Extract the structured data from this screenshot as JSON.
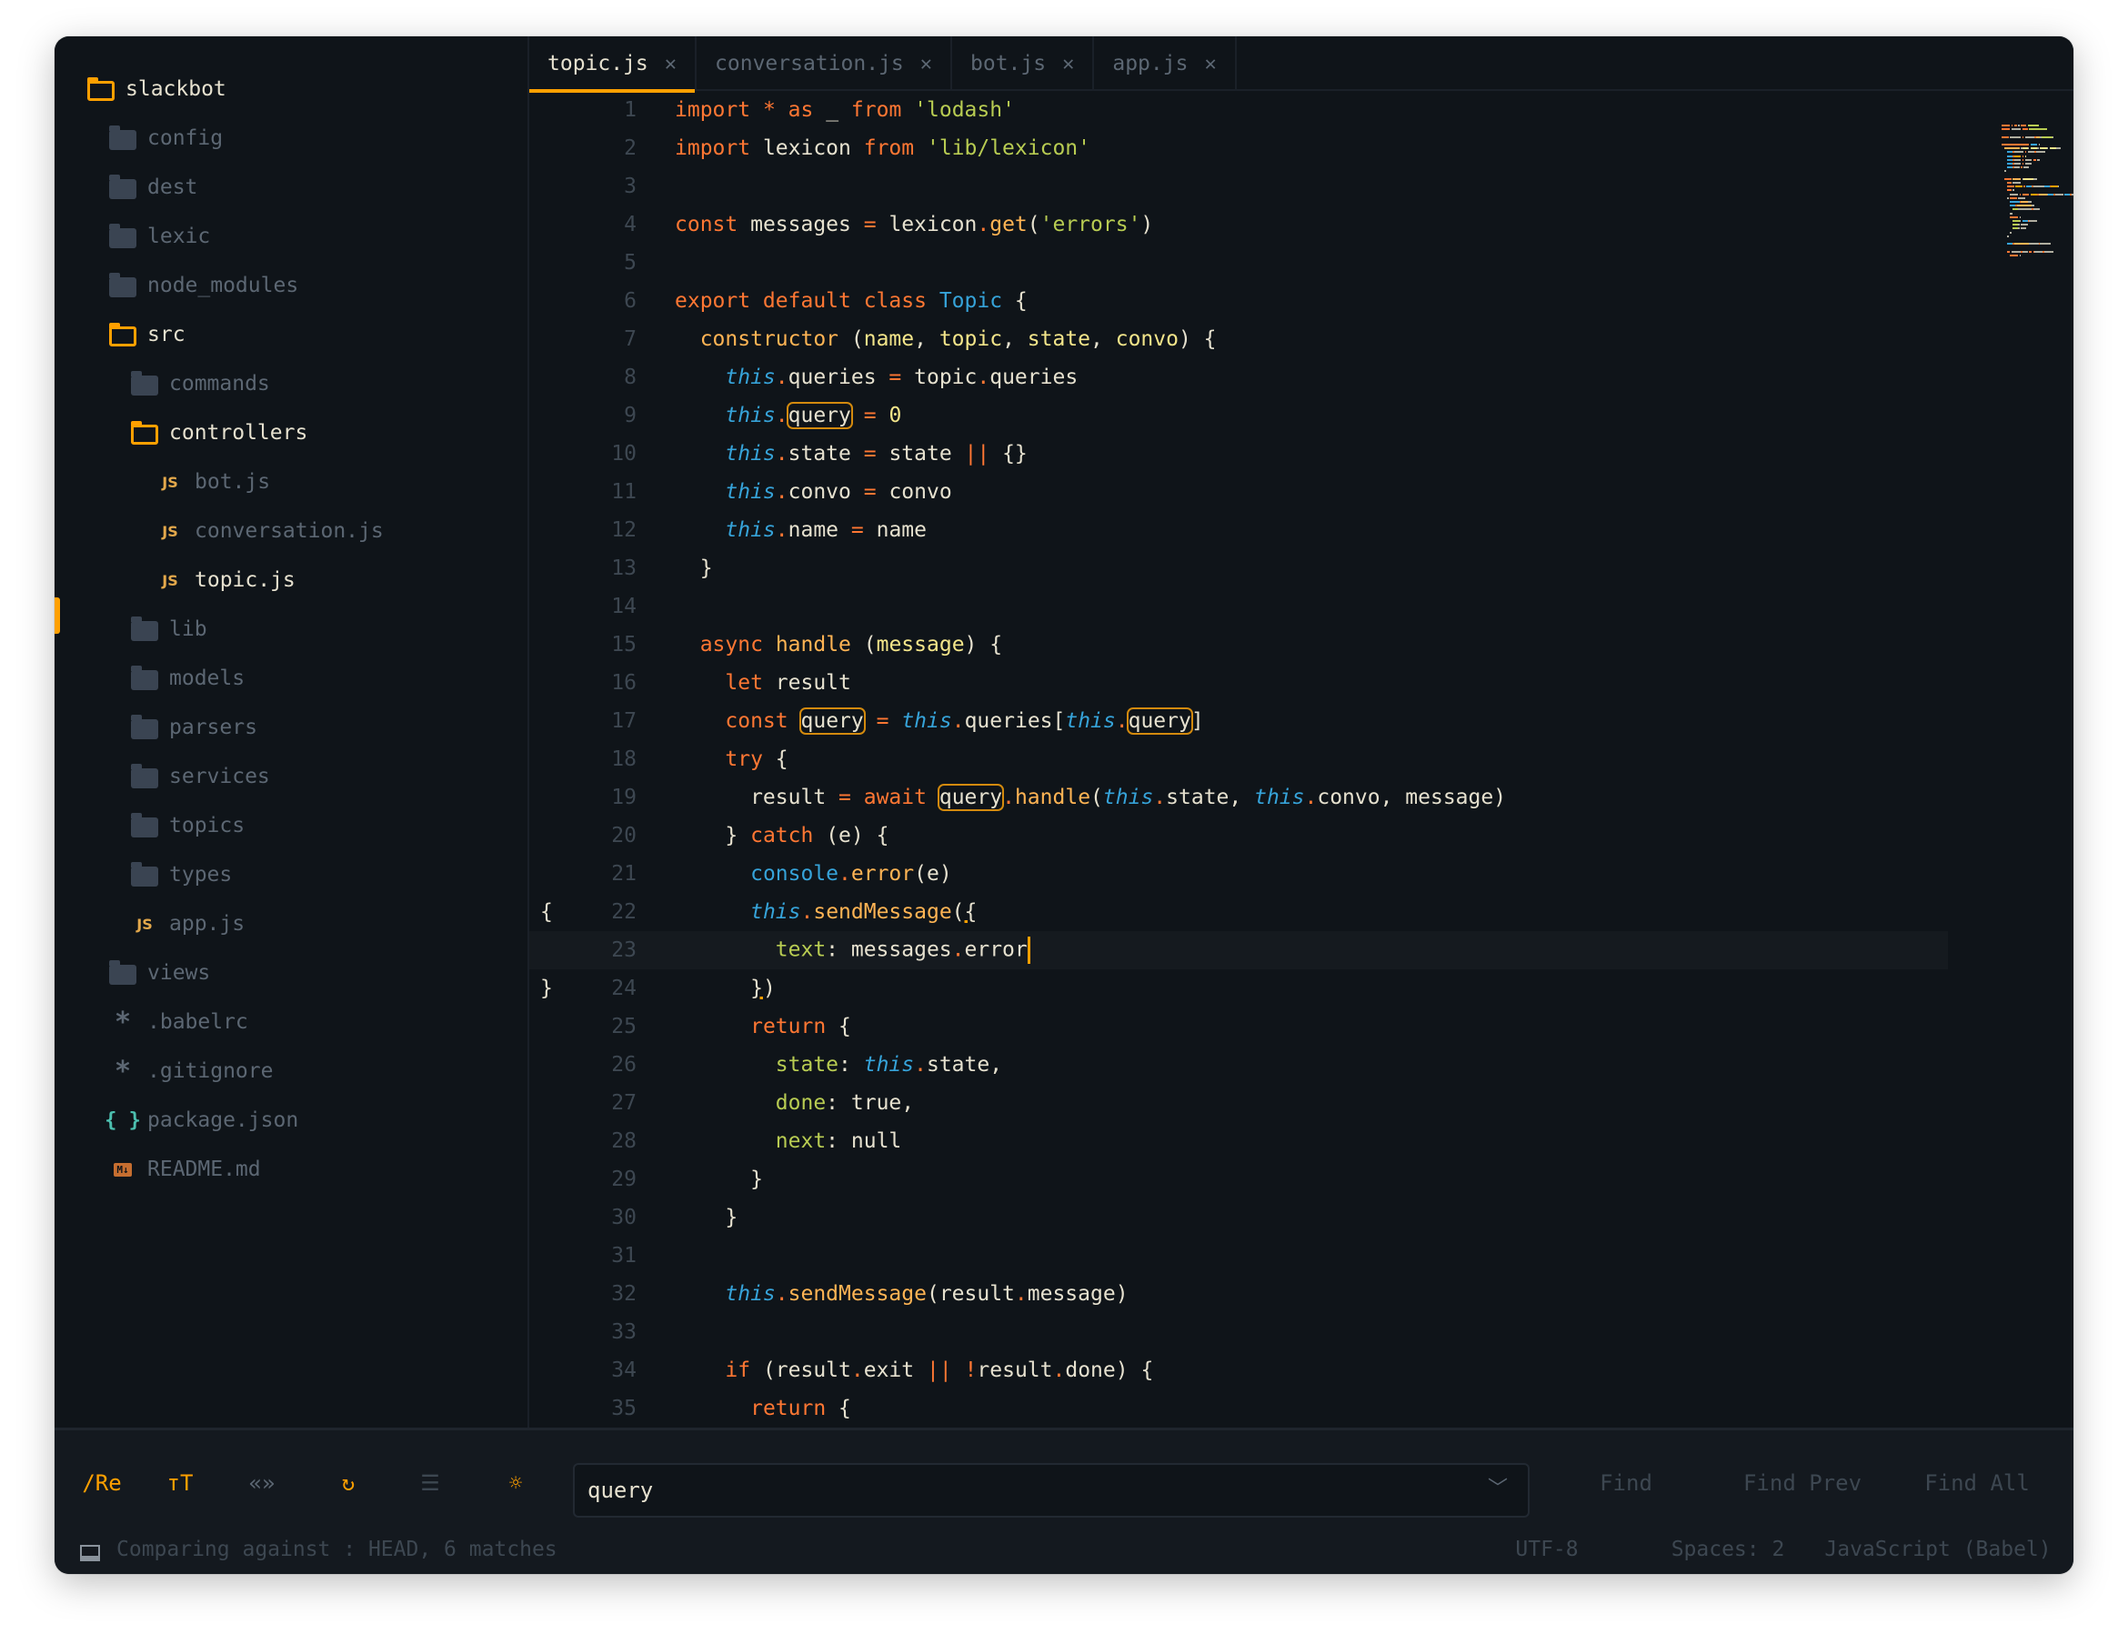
{
  "colors": {
    "accent": "#ffa000",
    "background": "#0f1419",
    "panel": "#14191f"
  },
  "sidebar": {
    "items": [
      {
        "label": "slackbot",
        "icon": "folder-open",
        "level": 0,
        "bright": true
      },
      {
        "label": "config",
        "icon": "folder",
        "level": 1
      },
      {
        "label": "dest",
        "icon": "folder",
        "level": 1
      },
      {
        "label": "lexic",
        "icon": "folder",
        "level": 1
      },
      {
        "label": "node_modules",
        "icon": "folder",
        "level": 1
      },
      {
        "label": "src",
        "icon": "folder-open",
        "level": 1,
        "bright": true
      },
      {
        "label": "commands",
        "icon": "folder",
        "level": 2
      },
      {
        "label": "controllers",
        "icon": "folder-open",
        "level": 2,
        "bright": true
      },
      {
        "label": "bot.js",
        "icon": "js",
        "level": 3
      },
      {
        "label": "conversation.js",
        "icon": "js",
        "level": 3
      },
      {
        "label": "topic.js",
        "icon": "js",
        "level": 3,
        "bright": true,
        "active": true
      },
      {
        "label": "lib",
        "icon": "folder",
        "level": 2
      },
      {
        "label": "models",
        "icon": "folder",
        "level": 2
      },
      {
        "label": "parsers",
        "icon": "folder",
        "level": 2
      },
      {
        "label": "services",
        "icon": "folder",
        "level": 2
      },
      {
        "label": "topics",
        "icon": "folder",
        "level": 2
      },
      {
        "label": "types",
        "icon": "folder",
        "level": 2
      },
      {
        "label": "app.js",
        "icon": "js",
        "level": 2
      },
      {
        "label": "views",
        "icon": "folder",
        "level": 1
      },
      {
        "label": ".babelrc",
        "icon": "asterisk",
        "level": 1
      },
      {
        "label": ".gitignore",
        "icon": "asterisk",
        "level": 1
      },
      {
        "label": "package.json",
        "icon": "braces",
        "level": 1
      },
      {
        "label": "README.md",
        "icon": "markdown",
        "level": 1
      }
    ],
    "icon_glyphs": {
      "js": "JS",
      "asterisk": "*",
      "braces": "{ }",
      "markdown": "M↓"
    }
  },
  "tabs": [
    {
      "label": "topic.js",
      "active": true
    },
    {
      "label": "conversation.js"
    },
    {
      "label": "bot.js"
    },
    {
      "label": "app.js"
    }
  ],
  "tab_close_glyph": "✕",
  "editor": {
    "current_line": 23,
    "bracket_marks": {
      "22": "{",
      "24": "}"
    },
    "lines": [
      [
        [
          "kw",
          "import"
        ],
        [
          "id",
          " "
        ],
        [
          "op",
          "*"
        ],
        [
          "id",
          " "
        ],
        [
          "kw",
          "as"
        ],
        [
          "id",
          " _ "
        ],
        [
          "kw",
          "from"
        ],
        [
          "id",
          " "
        ],
        [
          "str",
          "'lodash'"
        ]
      ],
      [
        [
          "kw",
          "import"
        ],
        [
          "id",
          " lexicon "
        ],
        [
          "kw",
          "from"
        ],
        [
          "id",
          " "
        ],
        [
          "str",
          "'lib/lexicon'"
        ]
      ],
      [],
      [
        [
          "kw",
          "const"
        ],
        [
          "id",
          " messages "
        ],
        [
          "op",
          "="
        ],
        [
          "id",
          " lexicon"
        ],
        [
          "op",
          "."
        ],
        [
          "fn",
          "get"
        ],
        [
          "id",
          "("
        ],
        [
          "str",
          "'errors'"
        ],
        [
          "id",
          ")"
        ]
      ],
      [],
      [
        [
          "kw",
          "export default class"
        ],
        [
          "id",
          " "
        ],
        [
          "cls",
          "Topic"
        ],
        [
          "id",
          " {"
        ]
      ],
      [
        [
          "id",
          "  "
        ],
        [
          "fn",
          "constructor"
        ],
        [
          "id",
          " ("
        ],
        [
          "param",
          "name"
        ],
        [
          "id",
          ", "
        ],
        [
          "param",
          "topic"
        ],
        [
          "id",
          ", "
        ],
        [
          "param",
          "state"
        ],
        [
          "id",
          ", "
        ],
        [
          "param",
          "convo"
        ],
        [
          "id",
          ") {"
        ]
      ],
      [
        [
          "id",
          "    "
        ],
        [
          "this",
          "this"
        ],
        [
          "op",
          "."
        ],
        [
          "id",
          "queries "
        ],
        [
          "op",
          "="
        ],
        [
          "id",
          " topic"
        ],
        [
          "op",
          "."
        ],
        [
          "id",
          "queries"
        ]
      ],
      [
        [
          "id",
          "    "
        ],
        [
          "this",
          "this"
        ],
        [
          "op",
          "."
        ],
        [
          "hl",
          "query"
        ],
        [
          "id",
          " "
        ],
        [
          "op",
          "="
        ],
        [
          "id",
          " "
        ],
        [
          "num",
          "0"
        ]
      ],
      [
        [
          "id",
          "    "
        ],
        [
          "this",
          "this"
        ],
        [
          "op",
          "."
        ],
        [
          "id",
          "state "
        ],
        [
          "op",
          "="
        ],
        [
          "id",
          " state "
        ],
        [
          "op",
          "||"
        ],
        [
          "id",
          " {}"
        ]
      ],
      [
        [
          "id",
          "    "
        ],
        [
          "this",
          "this"
        ],
        [
          "op",
          "."
        ],
        [
          "id",
          "convo "
        ],
        [
          "op",
          "="
        ],
        [
          "id",
          " convo"
        ]
      ],
      [
        [
          "id",
          "    "
        ],
        [
          "this",
          "this"
        ],
        [
          "op",
          "."
        ],
        [
          "id",
          "name "
        ],
        [
          "op",
          "="
        ],
        [
          "id",
          " name"
        ]
      ],
      [
        [
          "id",
          "  }"
        ]
      ],
      [],
      [
        [
          "id",
          "  "
        ],
        [
          "kw",
          "async"
        ],
        [
          "id",
          " "
        ],
        [
          "fn",
          "handle"
        ],
        [
          "id",
          " ("
        ],
        [
          "param",
          "message"
        ],
        [
          "id",
          ") {"
        ]
      ],
      [
        [
          "id",
          "    "
        ],
        [
          "kw",
          "let"
        ],
        [
          "id",
          " result"
        ]
      ],
      [
        [
          "id",
          "    "
        ],
        [
          "kw",
          "const"
        ],
        [
          "id",
          " "
        ],
        [
          "hl",
          "query"
        ],
        [
          "id",
          " "
        ],
        [
          "op",
          "="
        ],
        [
          "id",
          " "
        ],
        [
          "this",
          "this"
        ],
        [
          "op",
          "."
        ],
        [
          "id",
          "queries["
        ],
        [
          "this",
          "this"
        ],
        [
          "op",
          "."
        ],
        [
          "hl",
          "query"
        ],
        [
          "id",
          "]"
        ]
      ],
      [
        [
          "id",
          "    "
        ],
        [
          "kw",
          "try"
        ],
        [
          "id",
          " {"
        ]
      ],
      [
        [
          "id",
          "      result "
        ],
        [
          "op",
          "="
        ],
        [
          "id",
          " "
        ],
        [
          "kw",
          "await"
        ],
        [
          "id",
          " "
        ],
        [
          "hl",
          "query"
        ],
        [
          "op",
          "."
        ],
        [
          "fn",
          "handle"
        ],
        [
          "id",
          "("
        ],
        [
          "this",
          "this"
        ],
        [
          "op",
          "."
        ],
        [
          "id",
          "state, "
        ],
        [
          "this",
          "this"
        ],
        [
          "op",
          "."
        ],
        [
          "id",
          "convo, message)"
        ]
      ],
      [
        [
          "id",
          "    } "
        ],
        [
          "kw",
          "catch"
        ],
        [
          "id",
          " (e) {"
        ]
      ],
      [
        [
          "id",
          "      "
        ],
        [
          "cls",
          "console"
        ],
        [
          "op",
          "."
        ],
        [
          "fn",
          "error"
        ],
        [
          "id",
          "(e)"
        ]
      ],
      [
        [
          "id",
          "      "
        ],
        [
          "this",
          "this"
        ],
        [
          "op",
          "."
        ],
        [
          "fn",
          "sendMessage"
        ],
        [
          "id",
          "("
        ],
        [
          "under",
          "{"
        ]
      ],
      [
        [
          "id",
          "        "
        ],
        [
          "key",
          "text"
        ],
        [
          "id",
          ": messages"
        ],
        [
          "op",
          "."
        ],
        [
          "id",
          "error"
        ],
        [
          "caret",
          ""
        ]
      ],
      [
        [
          "id",
          "      "
        ],
        [
          "under",
          "}"
        ],
        [
          "id",
          ")"
        ]
      ],
      [
        [
          "id",
          "      "
        ],
        [
          "kw",
          "return"
        ],
        [
          "id",
          " {"
        ]
      ],
      [
        [
          "id",
          "        "
        ],
        [
          "key",
          "state"
        ],
        [
          "id",
          ": "
        ],
        [
          "this",
          "this"
        ],
        [
          "op",
          "."
        ],
        [
          "id",
          "state,"
        ]
      ],
      [
        [
          "id",
          "        "
        ],
        [
          "key",
          "done"
        ],
        [
          "id",
          ": "
        ],
        [
          "cons",
          "true"
        ],
        [
          "id",
          ","
        ]
      ],
      [
        [
          "id",
          "        "
        ],
        [
          "key",
          "next"
        ],
        [
          "id",
          ": "
        ],
        [
          "cons",
          "null"
        ]
      ],
      [
        [
          "id",
          "      }"
        ]
      ],
      [
        [
          "id",
          "    }"
        ]
      ],
      [],
      [
        [
          "id",
          "    "
        ],
        [
          "this",
          "this"
        ],
        [
          "op",
          "."
        ],
        [
          "fn",
          "sendMessage"
        ],
        [
          "id",
          "(result"
        ],
        [
          "op",
          "."
        ],
        [
          "id",
          "message)"
        ]
      ],
      [],
      [
        [
          "id",
          "    "
        ],
        [
          "kw",
          "if"
        ],
        [
          "id",
          " (result"
        ],
        [
          "op",
          "."
        ],
        [
          "id",
          "exit "
        ],
        [
          "op",
          "||"
        ],
        [
          "id",
          " "
        ],
        [
          "op",
          "!"
        ],
        [
          "id",
          "result"
        ],
        [
          "op",
          "."
        ],
        [
          "id",
          "done) {"
        ]
      ],
      [
        [
          "id",
          "      "
        ],
        [
          "kw",
          "return"
        ],
        [
          "id",
          " {"
        ]
      ]
    ]
  },
  "find_bar": {
    "tools": [
      {
        "label": "/Re",
        "name": "regex-toggle",
        "color": "#ffa000"
      },
      {
        "label": "тT",
        "name": "case-sensitive-toggle",
        "color": "#ffa000"
      },
      {
        "label": "«»",
        "name": "whole-word-toggle",
        "color": "#5c6773"
      },
      {
        "label": "↻",
        "name": "wrap-around-toggle",
        "color": "#ffa000"
      },
      {
        "label": "☰",
        "name": "in-selection-toggle",
        "color": "#3d4751"
      },
      {
        "label": "☼",
        "name": "highlight-matches-toggle",
        "color": "#ffa000"
      }
    ],
    "query": "query",
    "chevron": "﹀",
    "find": "Find",
    "find_prev": "Find Prev",
    "find_all": "Find All"
  },
  "status_bar": {
    "message": "Comparing against : HEAD, 6 matches",
    "encoding": "UTF-8",
    "indentation": "Spaces: 2",
    "syntax": "JavaScript (Babel)"
  }
}
